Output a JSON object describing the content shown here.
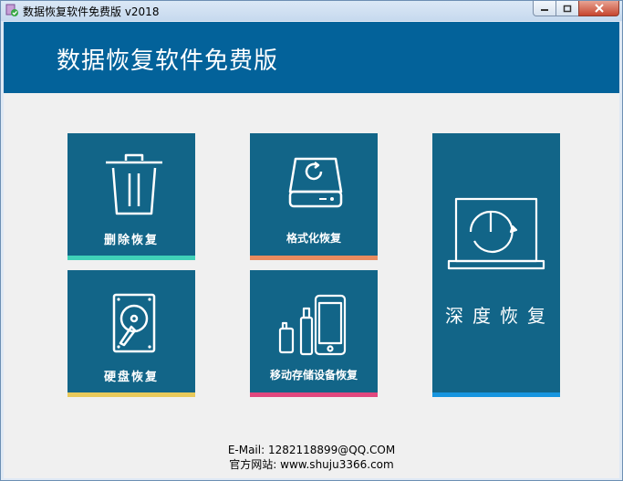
{
  "window": {
    "title": "数据恢复软件免费版 v2018"
  },
  "banner": {
    "title": "数据恢复软件免费版"
  },
  "tiles": [
    {
      "label": "删除恢复",
      "icon": "trash-icon",
      "accent": "#3fd1b8"
    },
    {
      "label": "格式化恢复",
      "icon": "drive-icon",
      "accent": "#e98b5f"
    },
    {
      "label": "硬盘恢复",
      "icon": "hard-disk-icon",
      "accent": "#e9c95a"
    },
    {
      "label": "移动存储设备恢复",
      "icon": "mobile-storage-icon",
      "accent": "#e2477e"
    },
    {
      "label": "深度恢复",
      "icon": "monitor-scan-icon",
      "accent": "#1795df"
    }
  ],
  "footer": {
    "email": "E-Mail:  1282118899@QQ.COM",
    "website": "官方网站: www.shuju3366.com"
  },
  "colors": {
    "banner": "#03629a",
    "tile": "#126588"
  }
}
